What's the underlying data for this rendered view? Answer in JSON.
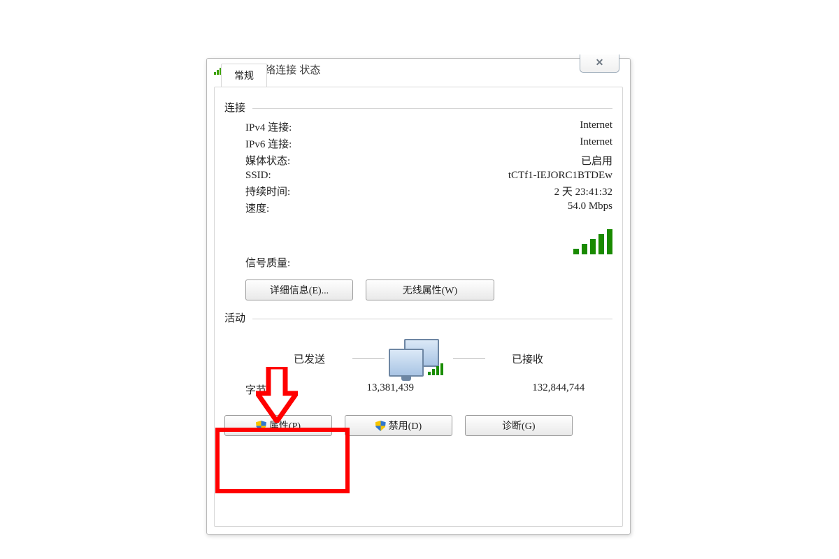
{
  "window": {
    "title": "无线网络连接 状态",
    "close_glyph": "✕"
  },
  "tab": {
    "general": "常规"
  },
  "connection": {
    "section_title": "连接",
    "ipv4_label": "IPv4 连接:",
    "ipv4_value": "Internet",
    "ipv6_label": "IPv6 连接:",
    "ipv6_value": "Internet",
    "media_label": "媒体状态:",
    "media_value": "已启用",
    "ssid_label": "SSID:",
    "ssid_value": "tCTf1-IEJORC1BTDEw",
    "duration_label": "持续时间:",
    "duration_value": "2 天 23:41:32",
    "speed_label": "速度:",
    "speed_value": "54.0 Mbps",
    "signal_label": "信号质量:"
  },
  "buttons": {
    "details": "详细信息(E)...",
    "wireless": "无线属性(W)",
    "properties": "属性(P)",
    "disable": "禁用(D)",
    "diagnose": "诊断(G)"
  },
  "activity": {
    "section_title": "活动",
    "sent_label": "已发送",
    "recv_label": "已接收",
    "bytes_label": "字节:",
    "bytes_sent": "13,381,439",
    "bytes_recv": "132,844,744"
  }
}
